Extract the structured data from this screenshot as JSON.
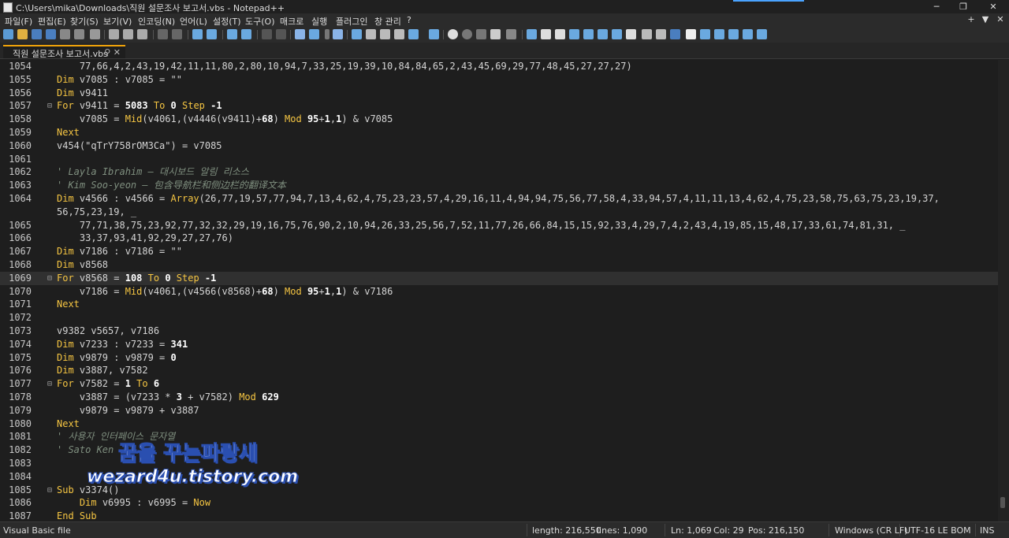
{
  "window": {
    "title": "C:\\Users\\mika\\Downloads\\직원 설문조사 보고서.vbs - Notepad++",
    "minimize": "─",
    "maximize": "❐",
    "close": "✕"
  },
  "menu": {
    "items": [
      "파일(F)",
      "편집(E)",
      "찾기(S)",
      "보기(V)",
      "인코딩(N)",
      "언어(L)",
      "설정(T)",
      "도구(O)",
      "매크로",
      "실행",
      "플러그인",
      "창 관리",
      "?"
    ],
    "right_plus": "+",
    "right_arrow": "▼",
    "right_close": "✕"
  },
  "tab": {
    "label": "직원 설문조사 보고서.vbs",
    "pin": "⚲",
    "close": "✕"
  },
  "editor": {
    "current_line": 1069,
    "lines": [
      {
        "n": "1054",
        "fold": "",
        "tokens": [
          [
            "id",
            "    77,66,4,2,43,19,42,11,11,80,2,80,10,94,7,33,25,19,39,10,84,84,65,2,43,45,69,29,77,48,45,27,27,27)"
          ]
        ]
      },
      {
        "n": "1055",
        "fold": "",
        "tokens": [
          [
            "kw",
            "Dim"
          ],
          [
            "id",
            " v7085 : v7085 = "
          ],
          [
            "str",
            "\"\""
          ]
        ]
      },
      {
        "n": "1056",
        "fold": "",
        "tokens": [
          [
            "kw",
            "Dim"
          ],
          [
            "id",
            " v9411"
          ]
        ]
      },
      {
        "n": "1057",
        "fold": "⊟",
        "tokens": [
          [
            "kw",
            "For"
          ],
          [
            "id",
            " v9411 = "
          ],
          [
            "num",
            "5083"
          ],
          [
            "kw",
            " To "
          ],
          [
            "num",
            "0"
          ],
          [
            "kw",
            " Step "
          ],
          [
            "num",
            "-1"
          ]
        ]
      },
      {
        "n": "1058",
        "fold": "",
        "tokens": [
          [
            "id",
            "    v7085 = "
          ],
          [
            "kw",
            "Mid"
          ],
          [
            "id",
            "(v4061,(v4446(v9411)+"
          ],
          [
            "num",
            "68"
          ],
          [
            "id",
            ") "
          ],
          [
            "kw",
            "Mod"
          ],
          [
            "id",
            " "
          ],
          [
            "num",
            "95"
          ],
          [
            "id",
            "+"
          ],
          [
            "num",
            "1"
          ],
          [
            "id",
            ","
          ],
          [
            "num",
            "1"
          ],
          [
            "id",
            ") & v7085"
          ]
        ]
      },
      {
        "n": "1059",
        "fold": "",
        "tokens": [
          [
            "kw",
            "Next"
          ]
        ]
      },
      {
        "n": "1060",
        "fold": "",
        "tokens": [
          [
            "id",
            "v454("
          ],
          [
            "str",
            "\"qTrY758rOM3Ca\""
          ],
          [
            "id",
            ") = v7085"
          ]
        ]
      },
      {
        "n": "1061",
        "fold": "",
        "tokens": []
      },
      {
        "n": "1062",
        "fold": "",
        "tokens": [
          [
            "cm",
            "' Layla Ibrahim — 대시보드 알림 리소스"
          ]
        ]
      },
      {
        "n": "1063",
        "fold": "",
        "tokens": [
          [
            "cm",
            "' Kim Soo-yeon — 包含导航栏和侧边栏的翻译文本"
          ]
        ]
      },
      {
        "n": "1064",
        "fold": "",
        "tokens": [
          [
            "kw",
            "Dim"
          ],
          [
            "id",
            " v4566 : v4566 = "
          ],
          [
            "kw",
            "Array"
          ],
          [
            "id",
            "(26,77,19,57,77,94,7,13,4,62,4,75,23,23,57,4,29,16,11,4,94,94,75,56,77,58,4,33,94,57,4,11,11,13,4,62,4,75,23,58,75,63,75,23,19,37,"
          ]
        ]
      },
      {
        "n": "",
        "fold": "",
        "tokens": [
          [
            "id",
            "56,75,23,19, _"
          ]
        ]
      },
      {
        "n": "1065",
        "fold": "",
        "tokens": [
          [
            "id",
            "    77,71,38,75,23,92,77,32,32,29,19,16,75,76,90,2,10,94,26,33,25,56,7,52,11,77,26,66,84,15,15,92,33,4,29,7,4,2,43,4,19,85,15,48,17,33,61,74,81,31, _"
          ]
        ]
      },
      {
        "n": "1066",
        "fold": "",
        "tokens": [
          [
            "id",
            "    33,37,93,41,92,29,27,27,76)"
          ]
        ]
      },
      {
        "n": "1067",
        "fold": "",
        "tokens": [
          [
            "kw",
            "Dim"
          ],
          [
            "id",
            " v7186 : v7186 = "
          ],
          [
            "str",
            "\"\""
          ]
        ]
      },
      {
        "n": "1068",
        "fold": "",
        "tokens": [
          [
            "kw",
            "Dim"
          ],
          [
            "id",
            " v8568"
          ]
        ]
      },
      {
        "n": "1069",
        "fold": "⊟",
        "tokens": [
          [
            "kw",
            "For"
          ],
          [
            "id",
            " v8568 = "
          ],
          [
            "num",
            "108"
          ],
          [
            "kw",
            " To "
          ],
          [
            "num",
            "0"
          ],
          [
            "kw",
            " Step "
          ],
          [
            "num",
            "-1"
          ]
        ]
      },
      {
        "n": "1070",
        "fold": "",
        "tokens": [
          [
            "id",
            "    v7186 = "
          ],
          [
            "kw",
            "Mid"
          ],
          [
            "id",
            "(v4061,(v4566(v8568)+"
          ],
          [
            "num",
            "68"
          ],
          [
            "id",
            ") "
          ],
          [
            "kw",
            "Mod"
          ],
          [
            "id",
            " "
          ],
          [
            "num",
            "95"
          ],
          [
            "id",
            "+"
          ],
          [
            "num",
            "1"
          ],
          [
            "id",
            ","
          ],
          [
            "num",
            "1"
          ],
          [
            "id",
            ") & v7186"
          ]
        ]
      },
      {
        "n": "1071",
        "fold": "",
        "tokens": [
          [
            "kw",
            "Next"
          ]
        ]
      },
      {
        "n": "1072",
        "fold": "",
        "tokens": []
      },
      {
        "n": "1073",
        "fold": "",
        "tokens": [
          [
            "id",
            "v9382 v5657, v7186"
          ]
        ]
      },
      {
        "n": "1074",
        "fold": "",
        "tokens": [
          [
            "kw",
            "Dim"
          ],
          [
            "id",
            " v7233 : v7233 = "
          ],
          [
            "num",
            "341"
          ]
        ]
      },
      {
        "n": "1075",
        "fold": "",
        "tokens": [
          [
            "kw",
            "Dim"
          ],
          [
            "id",
            " v9879 : v9879 = "
          ],
          [
            "num",
            "0"
          ]
        ]
      },
      {
        "n": "1076",
        "fold": "",
        "tokens": [
          [
            "kw",
            "Dim"
          ],
          [
            "id",
            " v3887, v7582"
          ]
        ]
      },
      {
        "n": "1077",
        "fold": "⊟",
        "tokens": [
          [
            "kw",
            "For"
          ],
          [
            "id",
            " v7582 = "
          ],
          [
            "num",
            "1"
          ],
          [
            "kw",
            " To "
          ],
          [
            "num",
            "6"
          ]
        ]
      },
      {
        "n": "1078",
        "fold": "",
        "tokens": [
          [
            "id",
            "    v3887 = (v7233 * "
          ],
          [
            "num",
            "3"
          ],
          [
            "id",
            " + v7582) "
          ],
          [
            "kw",
            "Mod"
          ],
          [
            "id",
            " "
          ],
          [
            "num",
            "629"
          ]
        ]
      },
      {
        "n": "1079",
        "fold": "",
        "tokens": [
          [
            "id",
            "    v9879 = v9879 + v3887"
          ]
        ]
      },
      {
        "n": "1080",
        "fold": "",
        "tokens": [
          [
            "kw",
            "Next"
          ]
        ]
      },
      {
        "n": "1081",
        "fold": "",
        "tokens": [
          [
            "cm",
            "' 사용자 인터페이스 문자열"
          ]
        ]
      },
      {
        "n": "1082",
        "fold": "",
        "tokens": [
          [
            "cm",
            "' Sato Ken"
          ]
        ]
      },
      {
        "n": "1083",
        "fold": "",
        "tokens": []
      },
      {
        "n": "1084",
        "fold": "",
        "tokens": []
      },
      {
        "n": "1085",
        "fold": "⊟",
        "tokens": [
          [
            "kw",
            "Sub"
          ],
          [
            "id",
            " v3374()"
          ]
        ]
      },
      {
        "n": "1086",
        "fold": "",
        "tokens": [
          [
            "id",
            "    "
          ],
          [
            "kw",
            "Dim"
          ],
          [
            "id",
            " v6995 : v6995 = "
          ],
          [
            "kw",
            "Now"
          ]
        ]
      },
      {
        "n": "1087",
        "fold": "",
        "tokens": [
          [
            "kw",
            "End Sub"
          ]
        ]
      }
    ]
  },
  "watermark": {
    "line1": "꿈을 꾸는파랑새",
    "line2": "wezard4u.tistory.com"
  },
  "status": {
    "file_type": "Visual Basic file",
    "length": "length: 216,550",
    "lines": "lines: 1,090",
    "ln": "Ln: 1,069",
    "col": "Col: 29",
    "pos": "Pos: 216,150",
    "eol": "Windows (CR LF)",
    "encoding": "UTF-16 LE BOM",
    "mode": "INS"
  },
  "colors": {
    "background": "#1e1e1e",
    "current_line": "#303030",
    "keyword": "#f5c542",
    "comment": "#7f8f7f",
    "tab_accent": "#f0a30a"
  }
}
